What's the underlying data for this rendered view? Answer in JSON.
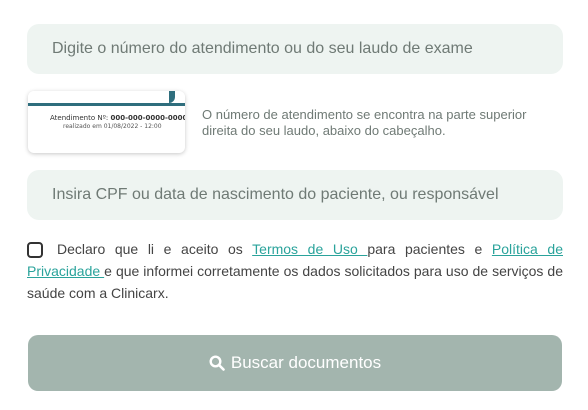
{
  "atendimento_field": {
    "placeholder": "Digite o número do atendimento ou do seu laudo de exame"
  },
  "hint": {
    "image_line1_label": "Atendimento Nº:",
    "image_line1_value": "000-000-0000-0000",
    "image_line2": "realizado em 01/08/2022 - 12:00",
    "text": "O número de atendimento se encontra na parte superior direita do seu laudo, abaixo do cabeçalho."
  },
  "cpf_field": {
    "placeholder": "Insira CPF ou data de nascimento do paciente, ou responsável"
  },
  "consent": {
    "checked": false,
    "text_before": "Declaro que li e aceito os ",
    "terms_link": "Termos de Uso ",
    "text_middle": "para pacientes e ",
    "privacy_link": "Política de Privacidade ",
    "text_after": "e que informei corretamente os dados solicitados para uso de serviços de saúde com a Clinicarx."
  },
  "search_button": {
    "label": "Buscar documentos",
    "icon": "search-icon"
  },
  "colors": {
    "field_bg": "#eef4f1",
    "link": "#2aa39b",
    "button_bg": "#a3b5ae",
    "header_accent": "#2f6e7d"
  }
}
